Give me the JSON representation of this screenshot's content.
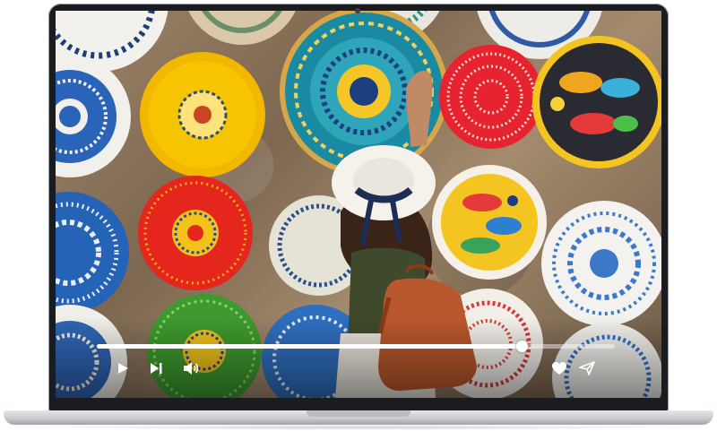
{
  "player": {
    "progress": 0.82,
    "controls": [
      {
        "name": "play-button",
        "icon": "play-icon"
      },
      {
        "name": "next-button",
        "icon": "skip-next-icon"
      },
      {
        "name": "volume-button",
        "icon": "volume-icon"
      },
      {
        "name": "like-button",
        "icon": "heart-icon"
      },
      {
        "name": "share-button",
        "icon": "send-icon"
      }
    ]
  },
  "colors": {
    "bezel": "#1b1c1f",
    "chassis": "#c9ccd0",
    "control": "#ffffff"
  }
}
